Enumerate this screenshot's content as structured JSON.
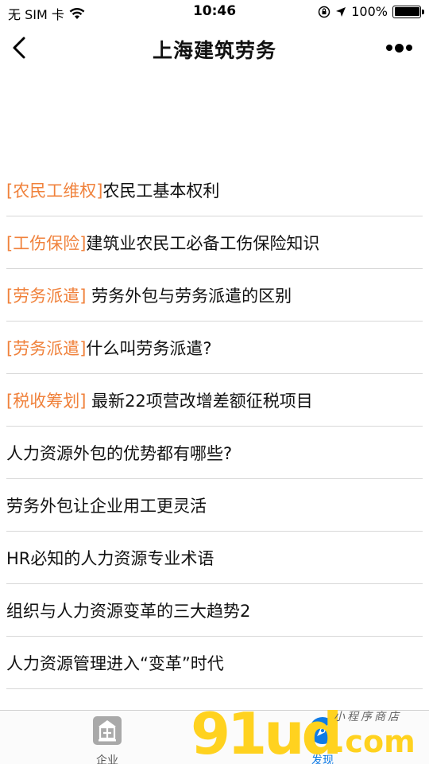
{
  "status_bar": {
    "carrier": "无 SIM 卡",
    "time": "10:46",
    "battery": "100%"
  },
  "nav": {
    "title": "上海建筑劳务"
  },
  "articles": [
    {
      "tag": "[农民工维权]",
      "title": "农民工基本权利"
    },
    {
      "tag": "[工伤保险]",
      "title": "建筑业农民工必备工伤保险知识"
    },
    {
      "tag": "[劳务派遣]",
      "title": " 劳务外包与劳务派遣的区别"
    },
    {
      "tag": "[劳务派遣]",
      "title": "什么叫劳务派遣?"
    },
    {
      "tag": "[税收筹划]",
      "title": " 最新22项营改增差额征税项目"
    },
    {
      "tag": "",
      "title": "人力资源外包的优势都有哪些?"
    },
    {
      "tag": "",
      "title": "劳务外包让企业用工更灵活"
    },
    {
      "tag": "",
      "title": "HR必知的人力资源专业术语"
    },
    {
      "tag": "",
      "title": "组织与人力资源变革的三大趋势2"
    },
    {
      "tag": "",
      "title": "人力资源管理进入“变革”时代"
    }
  ],
  "tab_bar": {
    "tabs": [
      {
        "label": "企业",
        "icon": "company-icon"
      },
      {
        "label": "发现",
        "icon": "compass-icon"
      }
    ]
  },
  "watermark": {
    "main": "91ud",
    "suffix": ".com",
    "sub": "小程序商店"
  },
  "colors": {
    "tag": "#f0823c",
    "active_tab": "#0f7be6",
    "watermark": "#ffd21f"
  }
}
